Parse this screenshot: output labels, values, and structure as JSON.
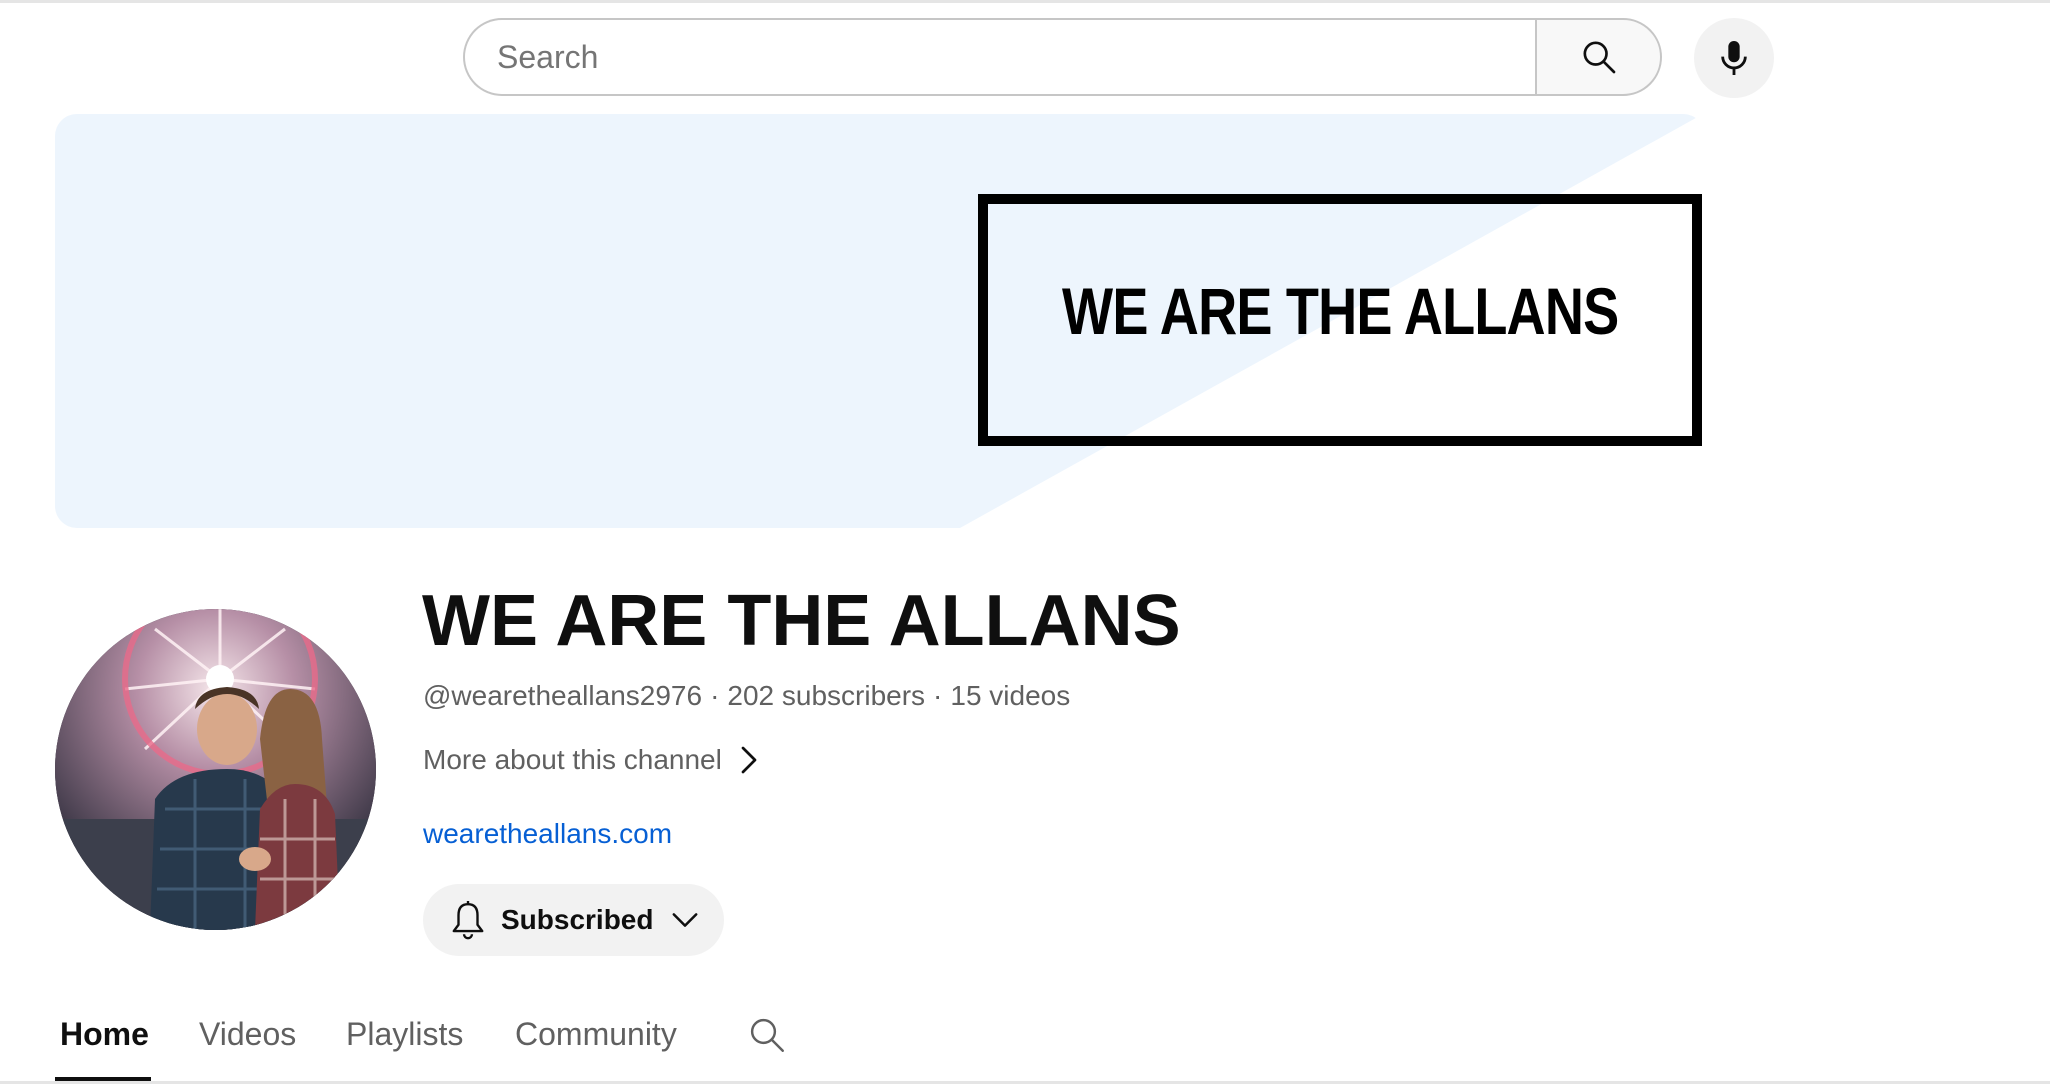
{
  "search": {
    "placeholder": "Search"
  },
  "icons": {
    "search": "search-icon",
    "mic": "microphone-icon",
    "chevron_right": "chevron-right-icon",
    "bell": "bell-icon",
    "chevron_down": "chevron-down-icon"
  },
  "banner": {
    "title": "WE ARE THE ALLANS"
  },
  "channel": {
    "name": "WE ARE THE ALLANS",
    "handle": "@wearetheallans2976",
    "subscribers": "202 subscribers",
    "videos": "15 videos",
    "separator": "·",
    "more_about": "More about this channel",
    "link": "wearetheallans.com"
  },
  "subscribe_button": {
    "label": "Subscribed"
  },
  "tabs": [
    {
      "label": "Home",
      "active": true
    },
    {
      "label": "Videos"
    },
    {
      "label": "Playlists"
    },
    {
      "label": "Community"
    }
  ],
  "colors": {
    "link": "#065fd4",
    "banner_light": "#edf5fd",
    "secondary_text": "#606060",
    "button_bg": "#f2f2f2"
  }
}
